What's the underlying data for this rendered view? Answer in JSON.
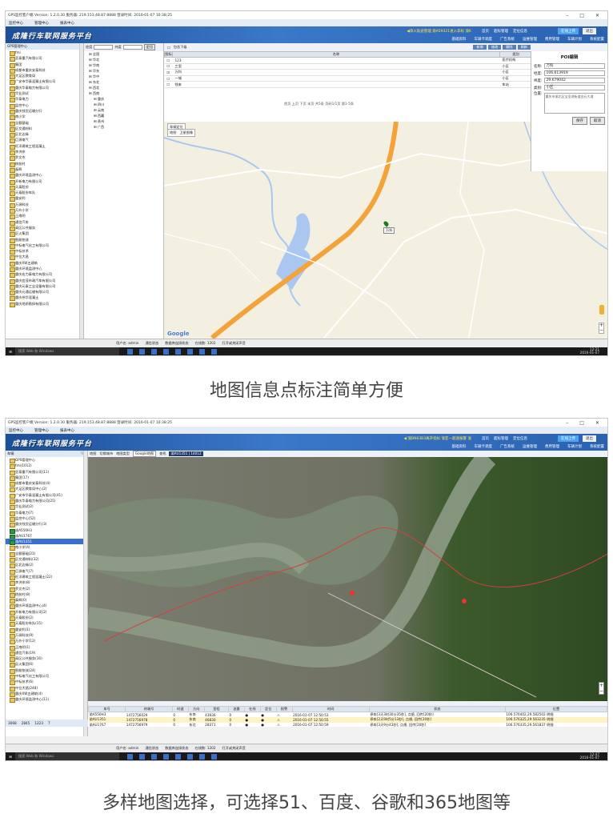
{
  "app": {
    "window_title": "GPS监控客户端  Version: 1.2.0.30  服务器: 219.153.48.87:8888  登录时间: 2016-01-07 10:38:25",
    "menu": [
      "监控中心",
      "管理中心",
      "报表中心"
    ],
    "logo": "成隆行车联网服务平台",
    "online_label": "在线上传",
    "exit_label": "退出",
    "nav_tabs": [
      "基础资料",
      "车辆卡调度",
      "广告系统",
      "运维管理",
      "费用管理",
      "车辆计划",
      "系统配置"
    ]
  },
  "screen1": {
    "ticker": "◀添入轨迹管理  渝A59321进入非标  渝K",
    "banner_links": [
      "首页",
      "超标管理",
      "定位信息"
    ],
    "tree_header": "GPS管理中心",
    "tree_items": [
      "fmi",
      "亚泰重汽有限公司",
      "集团",
      "成都市重庆安泰科技",
      "大足区教育局",
      "广安市华泰混凝土有限公司",
      "重庆华泰电力有限公司",
      "华业测试",
      "华泰电力",
      "监控中心",
      "重庆钱货运输分行",
      "南小学",
      "全额基础",
      "区交通材料",
      "区北边缘",
      "巨源电气",
      "旺洋建筑工程混凝土",
      "李洪岸",
      "罗文杰",
      "桃枝村",
      "泰辉",
      "重庆环境监测中心",
      "开新电力有限公司",
      "天泰股份",
      "天泰股份车队",
      "重安利",
      "万源科技",
      "万外小学",
      "王南明",
      "通信汽车",
      "高区公共服务",
      "区火集团",
      "智能物流",
      "中标电气化工有限公司",
      "中标技术",
      "中位大昌",
      "重庆XW五建筑",
      "重庆环境监测中心",
      "重庆宏力泰电力有限公司",
      "重庆宜茂市政汽车有限公司",
      "重庆元泰工业设备有限公司",
      "重庆元通运输有限公司",
      "重庆伟华混凝土",
      "重庆地质勘探有限公司"
    ],
    "region": {
      "label_range": "经度",
      "label_dim": "纬度",
      "locate_btn": "定位",
      "items": [
        "全国",
        "华北",
        "华南",
        "华东",
        "华中",
        "东北",
        "西北",
        "西南"
      ],
      "sub_items": [
        "重庆",
        "四川",
        "云南",
        "西藏",
        "贵州",
        "广西"
      ]
    },
    "poi_top_label": "包含下级",
    "poi_toolbar": [
      "新增",
      "修改",
      "删除",
      "刷新"
    ],
    "poi_columns": [
      "图标",
      "名称",
      "类别"
    ],
    "poi_rows": [
      {
        "name": "123",
        "type": "医疗机构",
        "checked": false
      },
      {
        "name": "三里",
        "type": "小区",
        "checked": false
      },
      {
        "name": "万科",
        "type": "小区",
        "checked": true
      },
      {
        "name": "一城",
        "type": "小区",
        "checked": false
      },
      {
        "name": "钱来",
        "type": "车站",
        "checked": false
      }
    ],
    "pager": "首页  上页  下页  末页  共5条  页码1/1页  第1-5条",
    "form": {
      "title": "POI编辑",
      "name_label": "名称:",
      "name_value": "万科",
      "lng_label": "经度:",
      "lng_value": "106.613919",
      "lat_label": "纬度:",
      "lat_value": "29.679042",
      "type_label": "类别:",
      "type_value": "小区",
      "addr_label": "位置:",
      "addr_value": "重庆市渝北区宝圣湖街道金石大道",
      "save": "保存",
      "cancel": "取消"
    },
    "map_locate": "车辆定位",
    "map_tabs": [
      "地图",
      "卫星图像"
    ],
    "marker_label": "万科",
    "statusbar": [
      "用户名: admin",
      "通信状态",
      "数据库连接状态",
      "在线数: 1202",
      "打开或关闭声音"
    ],
    "taskbar_search": "搜索 Web 和 Windows",
    "clock_time": "12:21",
    "clock_date": "2016-01-07"
  },
  "caption1": "地图信息点标注简单方便",
  "screen2": {
    "ticker": "◀  渝BN63B3离开指标 渝亚一超速报警 渝",
    "banner_links": [
      "首页",
      "超标管理",
      "定位信息"
    ],
    "tree_search_label": "车辆",
    "tree_items": [
      "GPS管理中心",
      "fmi(1012)",
      "亚泰重汽有限公司(11)",
      "集团(17)",
      "成都市重庆安泰科技(4)",
      "大足区教育局中心(2)",
      "广安市华泰混凝土有限公司(41)",
      "重庆华泰电力有限公司(25)",
      "华业测试(2)",
      "华泰电力(7)",
      "监控中心(52)",
      "重庆钱货运输分行(3)",
      "渝A550H3",
      "渝AU1767",
      "渝AU1351",
      "南小学(4)",
      "全额基础(21)",
      "区交通材料(32)",
      "区北边缘(2)",
      "巨源电气(7)",
      "旺洋建筑工程混凝土(22)",
      "李洪岸(8)",
      "罗文杰(2)",
      "桃枝村(8)",
      "泰辉(0)",
      "重庆环境监测中心(4)",
      "开新电力有限公司(2)",
      "天泰股份(2)",
      "天泰股份车队(15)",
      "重安利(1)",
      "万源科技(9)",
      "万外小学(12)",
      "王南明(1)",
      "通信汽车(19)",
      "高区公共服务(16)",
      "区火集团(6)",
      "智能物流(24)",
      "中标电气化工有限公司",
      "中标技术(6)",
      "中位大昌(248)",
      "重庆XW五建筑(4)",
      "重庆环境监测中心(11)"
    ],
    "tree_selected": "渝AU1351",
    "tree_cars": [
      "渝A550H3",
      "渝AU1767",
      "渝AU1351"
    ],
    "map_btn_labels": [
      "地图",
      "切换城市",
      "地图类型",
      "Google地图",
      "查找"
    ],
    "map_query": "渝AU1351 | 14012",
    "track_columns": [
      "车号",
      "终端号",
      "时速",
      "方向",
      "里程",
      "油量",
      "在线",
      "定位",
      "报警",
      "时间",
      "状态",
      "位置"
    ],
    "track_rows": [
      {
        "plate": "渝A550H3",
        "term": "1472756029",
        "speed": "0",
        "dir": "东南",
        "mile": "43936",
        "oil": "0",
        "time": "2016-01-07  12:50:53",
        "status": "停车[3天3时30分35秒], 点熄, 回传[20秒]",
        "pos": "106.576402,29.582502",
        "tag": "明细"
      },
      {
        "plate": "渝AU1351",
        "term": "1472756978",
        "speed": "0",
        "dir": "东南",
        "mile": "46830",
        "oil": "0",
        "time": "2016-01-07  12:50:55",
        "status": "停车[2天9时5分13秒], 点熄, 回传[20秒]",
        "pos": "106.576325,29.563235",
        "tag": "明细"
      },
      {
        "plate": "渝AU1767",
        "term": "1472756979",
        "speed": "0",
        "dir": "东北",
        "mile": "28371",
        "oil": "0",
        "time": "2016-01-07  12:50:59",
        "status": "停车[3天9分43秒], 点熄, 回传[20秒]",
        "pos": "106.576335,29.561837",
        "tag": "明细"
      }
    ],
    "mini_bar": [
      "3068",
      "2845",
      "1223",
      "7"
    ],
    "statusbar": [
      "用户名: admin",
      "通信状态",
      "数据库连接状态",
      "在线数: 1202",
      "打开或关闭声音"
    ],
    "taskbar_search": "搜索 Web 和 Windows",
    "clock_time": "12:47",
    "clock_date": "2016-01-07"
  },
  "caption2": "多样地图选择，可选择51、百度、谷歌和365地图等"
}
